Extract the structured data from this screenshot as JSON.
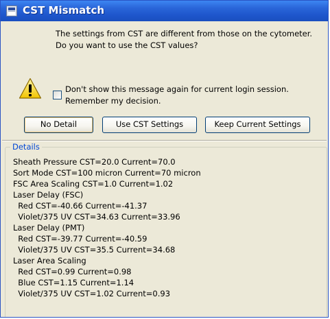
{
  "window": {
    "title": "CST Mismatch",
    "background": "#ece9d8",
    "titlebar_color": "#2a66d9"
  },
  "message": {
    "line1": "The settings from CST are different from those on the cytometer.",
    "line2": "Do you want to use the CST values?"
  },
  "checkbox": {
    "checked": false,
    "line1": "Don't show this message again for current login session.",
    "line2": "Remember my decision."
  },
  "buttons": {
    "no_detail": "No Detail",
    "use_cst": "Use CST Settings",
    "keep_current": "Keep Current Settings"
  },
  "details": {
    "legend": "Details",
    "lines": [
      "Sheath Pressure CST=20.0 Current=70.0",
      "Sort Mode CST=100 micron Current=70 micron",
      "FSC Area Scaling CST=1.0 Current=1.02",
      "Laser Delay (FSC)",
      "  Red CST=-40.66 Current=-41.37",
      "  Violet/375 UV CST=34.63 Current=33.96",
      "Laser Delay (PMT)",
      "  Red CST=-39.77 Current=-40.59",
      "  Violet/375 UV CST=35.5 Current=34.68",
      "Laser Area Scaling",
      "  Red CST=0.99 Current=0.98",
      "  Blue CST=1.15 Current=1.14",
      "  Violet/375 UV CST=1.02 Current=0.93"
    ]
  },
  "icons": {
    "title": "app-window-icon",
    "warning": "warning-icon"
  }
}
